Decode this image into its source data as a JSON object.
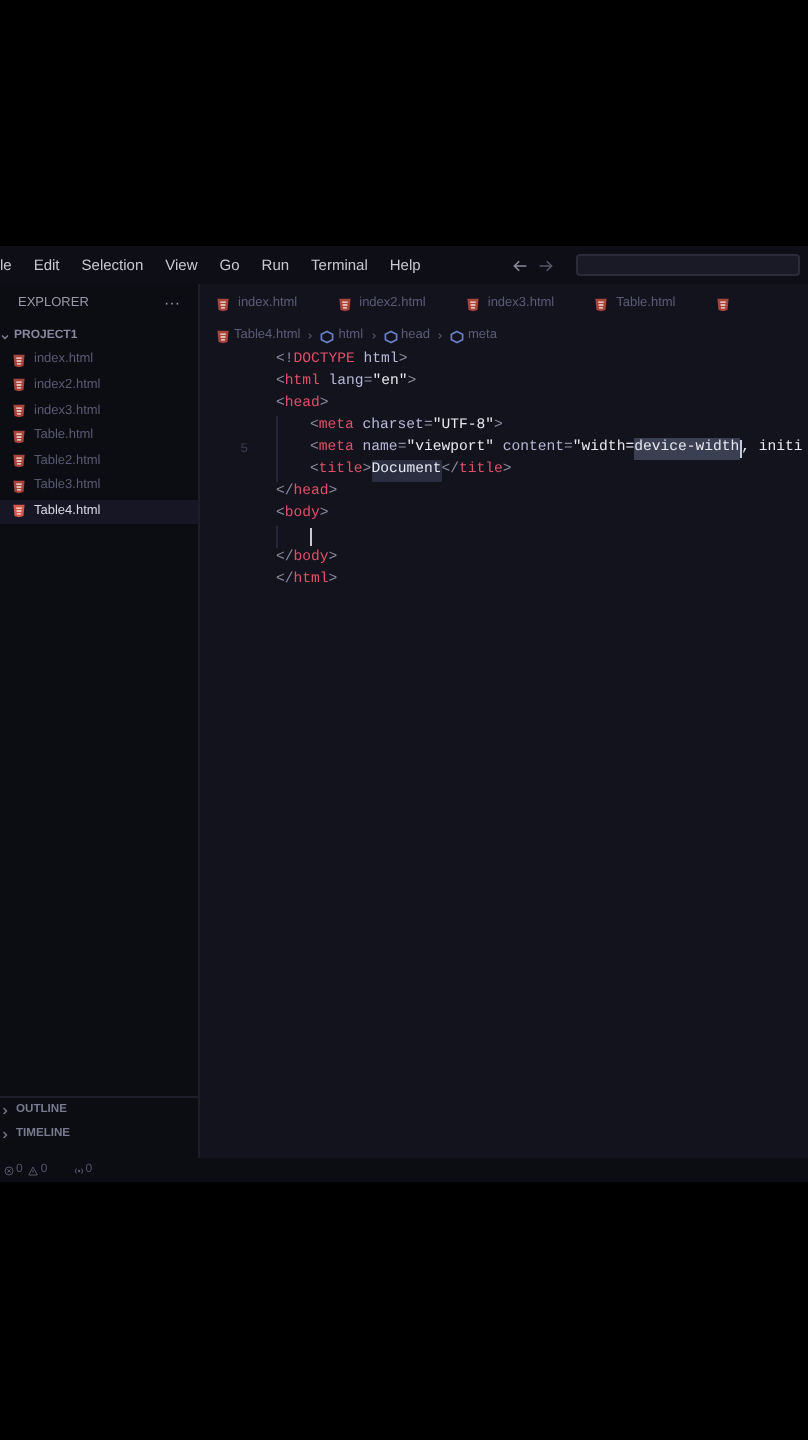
{
  "menu": [
    "le",
    "Edit",
    "Selection",
    "View",
    "Go",
    "Run",
    "Terminal",
    "Help"
  ],
  "explorer": {
    "title": "EXPLORER",
    "more": "···",
    "project": "PROJECT1",
    "files": [
      {
        "name": "index.html",
        "selected": false
      },
      {
        "name": "index2.html",
        "selected": false
      },
      {
        "name": "index3.html",
        "selected": false
      },
      {
        "name": "Table.html",
        "selected": false
      },
      {
        "name": "Table2.html",
        "selected": false
      },
      {
        "name": "Table3.html",
        "selected": false
      },
      {
        "name": "Table4.html",
        "selected": true
      }
    ],
    "panels": [
      "OUTLINE",
      "TIMELINE"
    ]
  },
  "tabs": [
    {
      "kind": "labelled",
      "label": "index.html"
    },
    {
      "kind": "labelled",
      "label": "index2.html"
    },
    {
      "kind": "labelled",
      "label": "index3.html"
    },
    {
      "kind": "labelled",
      "label": "Table.html"
    },
    {
      "kind": "cut_off"
    }
  ],
  "breadcrumbs": [
    {
      "kind": "file",
      "label": "Table4.html"
    },
    {
      "kind": "element",
      "label": "html"
    },
    {
      "kind": "element",
      "label": "head"
    },
    {
      "kind": "element",
      "label": "meta"
    }
  ],
  "code": [
    {
      "indented": false,
      "tokens": [
        {
          "kind": "punct",
          "text": "<!"
        },
        {
          "kind": "tag",
          "text": "DOCTYPE"
        },
        {
          "kind": "attr",
          "text": " html"
        },
        {
          "kind": "punct",
          "text": ">"
        }
      ]
    },
    {
      "indented": false,
      "tokens": [
        {
          "kind": "punct",
          "text": "<"
        },
        {
          "kind": "tag",
          "text": "html"
        },
        {
          "kind": "attr",
          "text": " lang"
        },
        {
          "kind": "punct",
          "text": "="
        },
        {
          "kind": "string",
          "text": "\"en\""
        },
        {
          "kind": "punct",
          "text": ">"
        }
      ]
    },
    {
      "indented": false,
      "tokens": [
        {
          "kind": "punct",
          "text": "<"
        },
        {
          "kind": "tag",
          "text": "head"
        },
        {
          "kind": "punct",
          "text": ">"
        }
      ]
    },
    {
      "indented": true,
      "tokens": [
        {
          "kind": "punct",
          "text": "<"
        },
        {
          "kind": "tag",
          "text": "meta"
        },
        {
          "kind": "attr",
          "text": " charset"
        },
        {
          "kind": "punct",
          "text": "="
        },
        {
          "kind": "string",
          "text": "\"UTF-8\""
        },
        {
          "kind": "punct",
          "text": ">"
        }
      ]
    },
    {
      "indented": true,
      "number": "5",
      "tokens": [
        {
          "kind": "punct",
          "text": "<"
        },
        {
          "kind": "tag",
          "text": "meta"
        },
        {
          "kind": "attr",
          "text": " name"
        },
        {
          "kind": "punct",
          "text": "="
        },
        {
          "kind": "string",
          "text": "\"viewport\""
        },
        {
          "kind": "attr",
          "text": " content"
        },
        {
          "kind": "punct",
          "text": "="
        },
        {
          "kind": "string",
          "text": "\"width="
        },
        {
          "kind": "selection",
          "text": "device-width"
        },
        {
          "kind": "cursor"
        },
        {
          "kind": "string",
          "text": ", initi"
        }
      ]
    },
    {
      "indented": true,
      "tokens": [
        {
          "kind": "punct",
          "text": "<"
        },
        {
          "kind": "tag",
          "text": "title"
        },
        {
          "kind": "punct",
          "text": ">"
        },
        {
          "kind": "highlight",
          "text": "Document"
        },
        {
          "kind": "punct",
          "text": "</"
        },
        {
          "kind": "tag",
          "text": "title"
        },
        {
          "kind": "punct",
          "text": ">"
        }
      ]
    },
    {
      "indented": false,
      "tokens": [
        {
          "kind": "punct",
          "text": "</"
        },
        {
          "kind": "tag",
          "text": "head"
        },
        {
          "kind": "punct",
          "text": ">"
        }
      ]
    },
    {
      "indented": false,
      "tokens": [
        {
          "kind": "punct",
          "text": "<"
        },
        {
          "kind": "tag",
          "text": "body"
        },
        {
          "kind": "punct",
          "text": ">"
        }
      ]
    },
    {
      "indented": true,
      "tokens": [
        {
          "kind": "cursor"
        }
      ]
    },
    {
      "indented": false,
      "tokens": [
        {
          "kind": "punct",
          "text": "</"
        },
        {
          "kind": "tag",
          "text": "body"
        },
        {
          "kind": "punct",
          "text": ">"
        }
      ]
    },
    {
      "indented": false,
      "tokens": [
        {
          "kind": "punct",
          "text": "</"
        },
        {
          "kind": "tag",
          "text": "html"
        },
        {
          "kind": "punct",
          "text": ">"
        }
      ]
    }
  ],
  "status_bar": [
    {
      "kind": "errors",
      "count": "0"
    },
    {
      "kind": "warnings",
      "count": "0"
    },
    {
      "kind": "ports",
      "count": "0"
    }
  ]
}
